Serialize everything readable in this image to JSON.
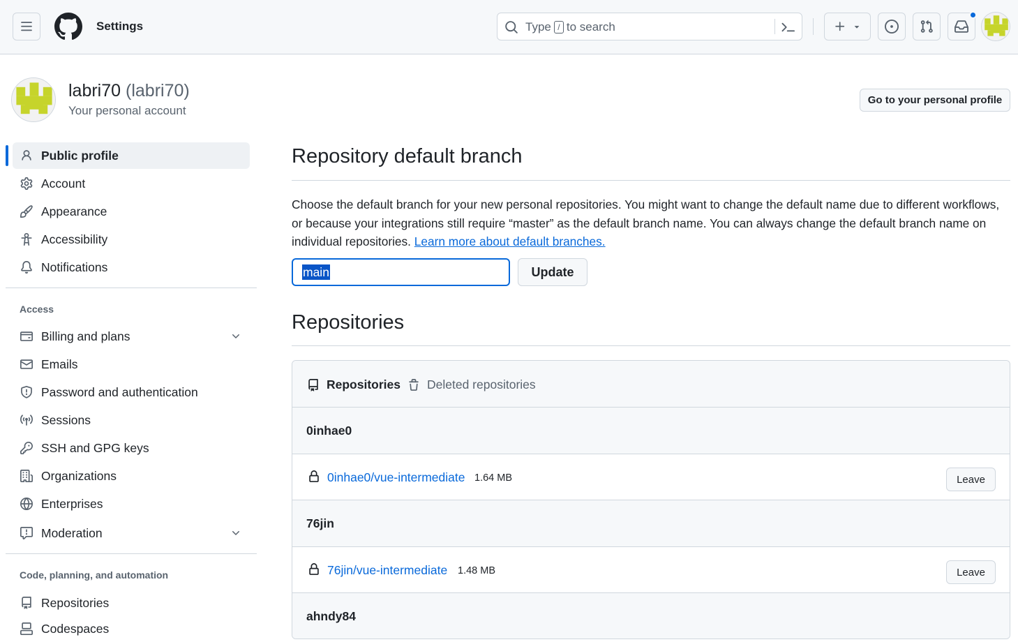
{
  "header": {
    "title": "Settings",
    "search_prefix": "Type",
    "search_key": "/",
    "search_suffix": "to search"
  },
  "account": {
    "display_name": "labri70",
    "login": "(labri70)",
    "subtitle": "Your personal account",
    "profile_button": "Go to your personal profile"
  },
  "sidebar": {
    "group1": [
      {
        "label": "Public profile",
        "icon": "person-icon",
        "active": true
      },
      {
        "label": "Account",
        "icon": "gear-icon"
      },
      {
        "label": "Appearance",
        "icon": "paintbrush-icon"
      },
      {
        "label": "Accessibility",
        "icon": "accessibility-icon"
      },
      {
        "label": "Notifications",
        "icon": "bell-icon"
      }
    ],
    "access_heading": "Access",
    "group2": [
      {
        "label": "Billing and plans",
        "icon": "credit-card-icon",
        "expandable": true
      },
      {
        "label": "Emails",
        "icon": "mail-icon"
      },
      {
        "label": "Password and authentication",
        "icon": "shield-icon"
      },
      {
        "label": "Sessions",
        "icon": "broadcast-icon"
      },
      {
        "label": "SSH and GPG keys",
        "icon": "key-icon"
      },
      {
        "label": "Organizations",
        "icon": "organization-icon"
      },
      {
        "label": "Enterprises",
        "icon": "globe-icon"
      },
      {
        "label": "Moderation",
        "icon": "report-icon",
        "expandable": true
      }
    ],
    "code_heading": "Code, planning, and automation",
    "group3": [
      {
        "label": "Repositories",
        "icon": "repo-icon"
      },
      {
        "label": "Codespaces",
        "icon": "codespaces-icon"
      }
    ]
  },
  "default_branch": {
    "title": "Repository default branch",
    "description": "Choose the default branch for your new personal repositories. You might want to change the default name due to different workflows, or because your integrations still require “master” as the default branch name. You can always change the default branch name on individual repositories.",
    "learn_more": "Learn more about default branches.",
    "input_value": "main",
    "update_button": "Update"
  },
  "repositories": {
    "title": "Repositories",
    "tab_active": "Repositories",
    "tab_deleted": "Deleted repositories",
    "groups": [
      {
        "owner": "0inhae0",
        "repo": "0inhae0/vue-intermediate",
        "size": "1.64 MB",
        "action": "Leave"
      },
      {
        "owner": "76jin",
        "repo": "76jin/vue-intermediate",
        "size": "1.48 MB",
        "action": "Leave"
      },
      {
        "owner": "ahndy84"
      }
    ]
  },
  "colors": {
    "accent": "#0969da",
    "avatar_green": "#c6d42b"
  }
}
